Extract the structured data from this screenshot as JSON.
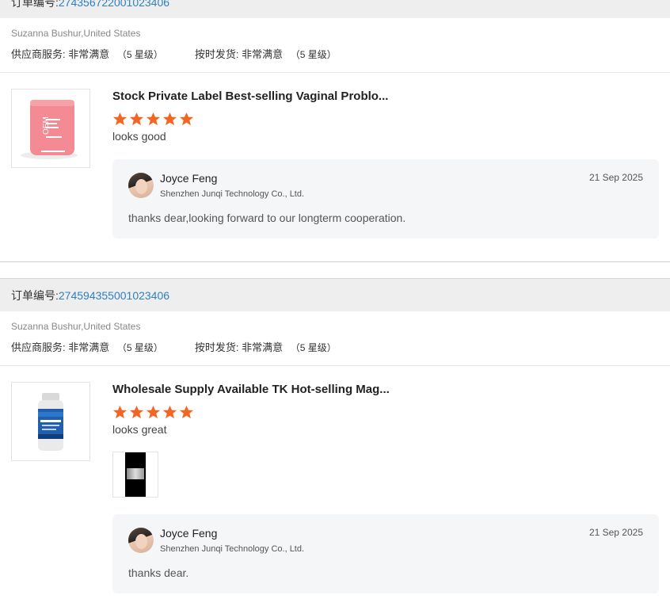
{
  "orders": [
    {
      "order_label": "订单编号:",
      "order_number": "274356722001023406",
      "buyer": "Suzanna Bushur,United States",
      "supplier_service_label": "供应商服务:",
      "supplier_service_value": "非常满意",
      "supplier_service_stars": "（5 星级）",
      "ontime_label": "按时发货:",
      "ontime_value": "非常满意",
      "ontime_stars": "（5 星级）",
      "product_title": "Stock Private Label Best-selling Vaginal Problo...",
      "rating": 5,
      "comment": "looks good",
      "reply": {
        "name": "Joyce Feng",
        "company": "Shenzhen Junqi Technology Co., Ltd.",
        "date": "21 Sep 2025",
        "text": "thanks dear,looking forward to our longterm cooperation."
      }
    },
    {
      "order_label": "订单编号:",
      "order_number": "274594355001023406",
      "buyer": "Suzanna Bushur,United States",
      "supplier_service_label": "供应商服务:",
      "supplier_service_value": "非常满意",
      "supplier_service_stars": "（5 星级）",
      "ontime_label": "按时发货:",
      "ontime_value": "非常满意",
      "ontime_stars": "（5 星级）",
      "product_title": "Wholesale Supply Available TK Hot-selling Mag...",
      "rating": 5,
      "comment": "looks great",
      "reply": {
        "name": "Joyce Feng",
        "company": "Shenzhen Junqi Technology Co., Ltd.",
        "date": "21 Sep 2025",
        "text": "thanks dear."
      }
    }
  ],
  "colors": {
    "star": "#f26522",
    "link": "#2f7fc1",
    "header_bg": "#eeeeee",
    "reply_bg": "#f4f6f8"
  },
  "icons": {
    "star": "star-icon",
    "avatar": "avatar",
    "product": "product-thumbnail",
    "video": "video-thumbnail"
  }
}
